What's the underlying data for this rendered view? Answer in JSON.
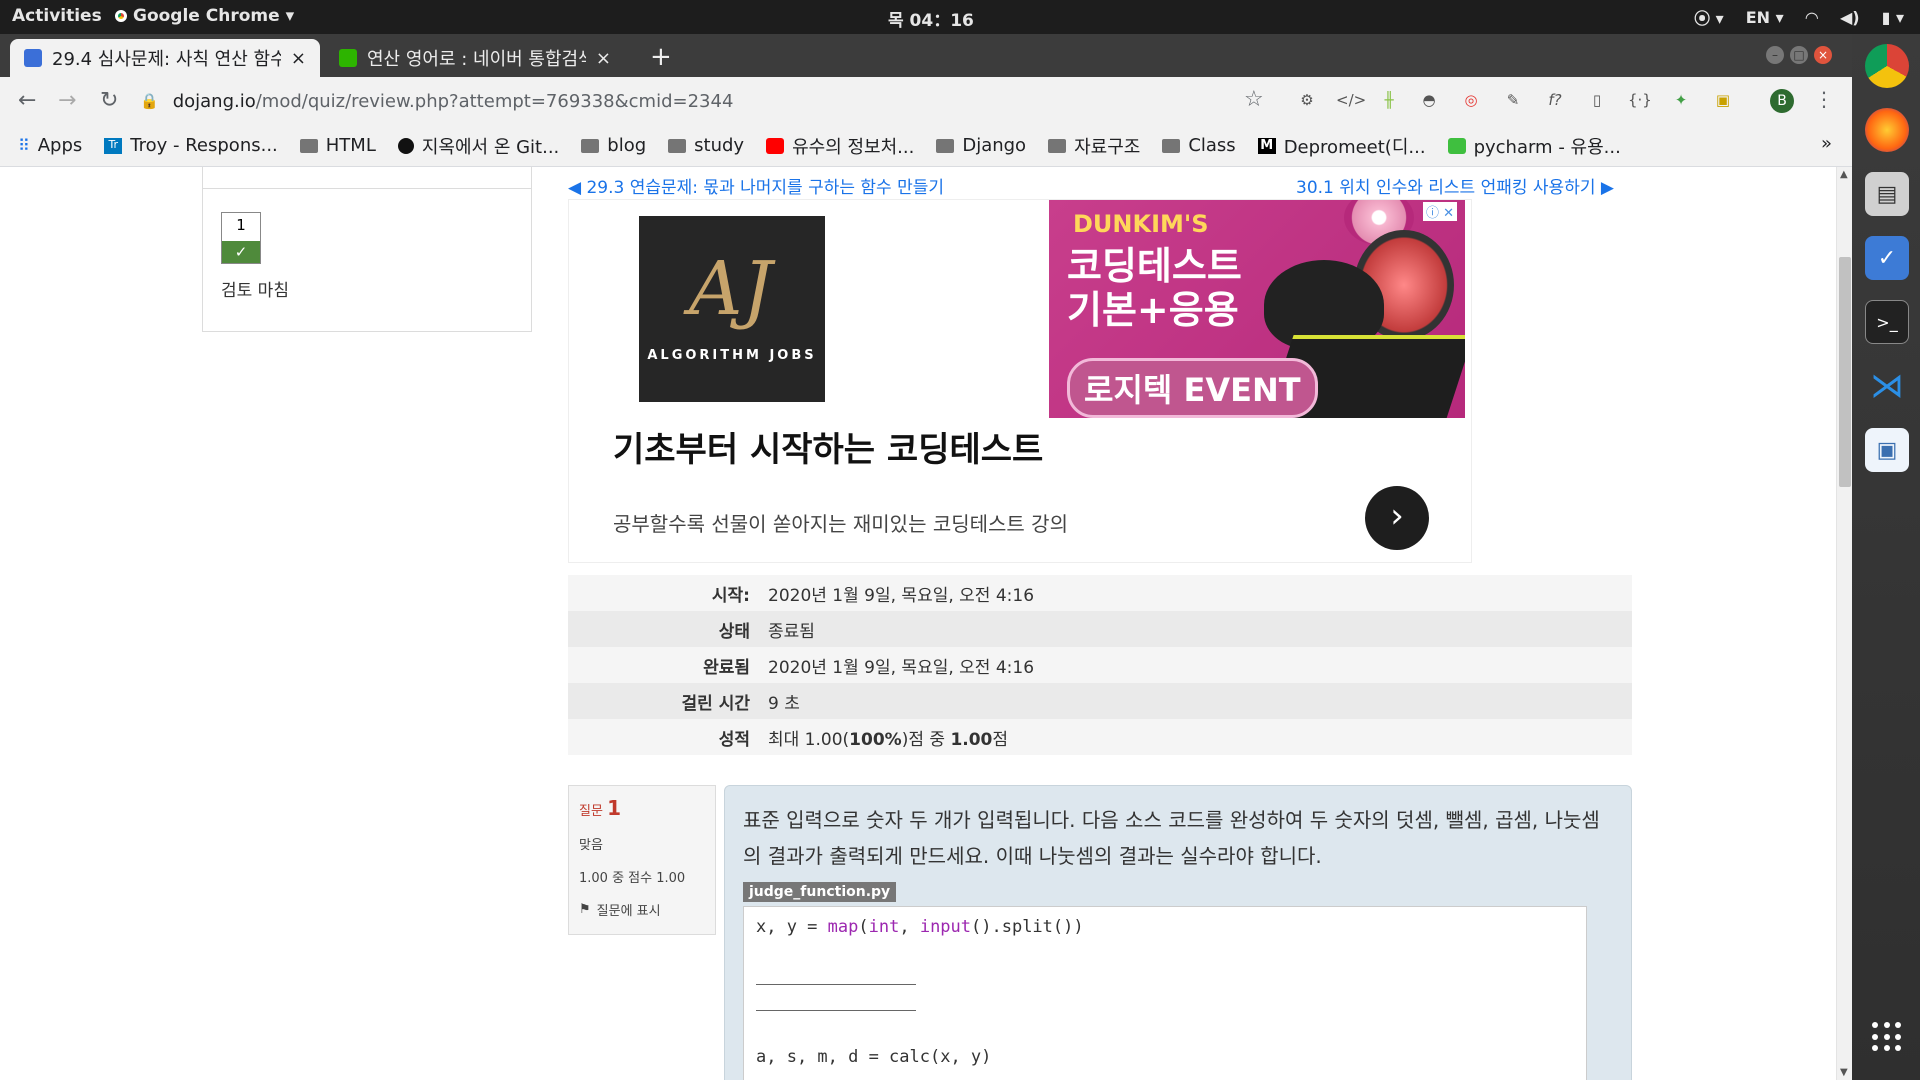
{
  "system": {
    "activities": "Activities",
    "app_menu": "Google Chrome",
    "clock": "목 04：16",
    "lang": "EN"
  },
  "tabs": [
    {
      "title": "29.4 심사문제: 사칙 연산 함수",
      "close": "×"
    },
    {
      "title": "연산 영어로 : 네이버 통합검색",
      "close": "×"
    }
  ],
  "new_tab": "+",
  "url": {
    "host": "dojang.io",
    "path": "/mod/quiz/review.php?attempt=769338&cmid=2344"
  },
  "profile_initial": "B",
  "bookmarks": [
    {
      "label": "Apps",
      "icon": "apps-grid-icon"
    },
    {
      "label": "Troy - Respons...",
      "icon": "trello-icon"
    },
    {
      "label": "HTML",
      "icon": "folder-icon"
    },
    {
      "label": "지옥에서 온 Git...",
      "icon": "circle-icon"
    },
    {
      "label": "blog",
      "icon": "folder-icon"
    },
    {
      "label": "study",
      "icon": "folder-icon"
    },
    {
      "label": "유수의 정보처...",
      "icon": "youtube-icon"
    },
    {
      "label": "Django",
      "icon": "folder-icon"
    },
    {
      "label": "자료구조",
      "icon": "folder-icon"
    },
    {
      "label": "Class",
      "icon": "folder-icon"
    },
    {
      "label": "Depromeet(디...",
      "icon": "medium-icon"
    },
    {
      "label": "pycharm - 유용...",
      "icon": "chat-icon"
    }
  ],
  "bookmarks_more": "»",
  "quiz_nav": {
    "question_number": "1",
    "finish_review": "검토 마침"
  },
  "nav": {
    "prev": "◀ 29.3 연습문제: 몫과 나머지를 구하는 함수 만들기",
    "next": "30.1 위치 인수와 리스트 언패킹 사용하기 ▶"
  },
  "ad": {
    "logo_text": "ALGORITHM JOBS",
    "banner_brand": "DUNKIM'S",
    "banner_title": "코딩테스트 기본+응용",
    "banner_event": "로지텍 EVENT",
    "headline": "기초부터 시작하는 코딩테스트",
    "subtext": "공부할수록 선물이 쏟아지는 재미있는 코딩테스트 강의"
  },
  "summary": [
    {
      "label": "시작:",
      "value": "2020년 1월 9일, 목요일, 오전 4:16"
    },
    {
      "label": "상태",
      "value": "종료됨"
    },
    {
      "label": "완료됨",
      "value": "2020년 1월 9일, 목요일, 오전 4:16"
    },
    {
      "label": "걸린 시간",
      "value": "9 초"
    },
    {
      "label": "성적",
      "value_parts": [
        "최대 1.00(",
        "100%",
        ")점 중 ",
        "1.00",
        "점"
      ]
    }
  ],
  "question": {
    "label": "질문",
    "number": "1",
    "state": "맞음",
    "grade": "1.00 중 점수 1.00",
    "flag": "질문에 표시",
    "text": "표준 입력으로 숫자 두 개가 입력됩니다. 다음 소스 코드를 완성하여 두 숫자의 덧셈, 뺄셈, 곱셈, 나눗셈의 결과가 출력되게 만드세요. 이때 나눗셈의 결과는 실수라야 합니다.",
    "filename": "judge_function.py",
    "code_line1_pre": "x, y = ",
    "code_line1_map": "map",
    "code_line1_mid": "(",
    "code_line1_int": "int",
    "code_line1_sep": ", ",
    "code_line1_input": "input",
    "code_line1_post": "().split())",
    "code_line_last": "a, s, m, d = calc(x, y)"
  }
}
